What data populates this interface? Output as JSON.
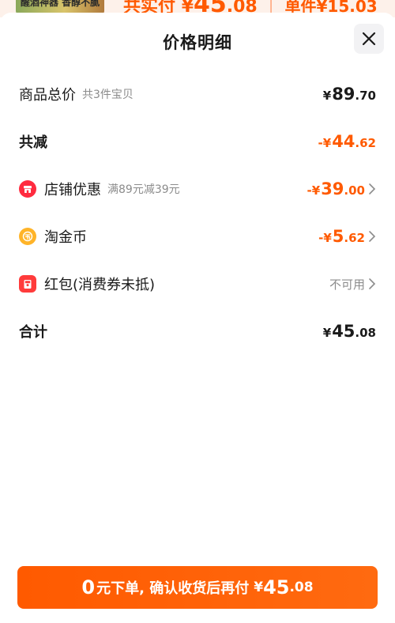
{
  "backdrop": {
    "thumb_text": "醒酒神器 香醇不腻",
    "price_prefix": "共实付",
    "price_symbol": "¥",
    "price_int": "45",
    "price_dec": ".08",
    "separator": "|",
    "unit_text": "单件¥15.03"
  },
  "sheet": {
    "title": "价格明细"
  },
  "rows": {
    "total": {
      "label": "商品总价",
      "sub": "共3件宝贝",
      "symbol": "¥",
      "int": "89",
      "dec": ".70"
    },
    "reduce": {
      "label": "共减",
      "symbol": "-¥",
      "int": "44",
      "dec": ".62"
    },
    "store": {
      "label": "店铺优惠",
      "sub": "满89元减39元",
      "symbol": "-¥",
      "int": "39",
      "dec": ".00"
    },
    "coin": {
      "label": "淘金币",
      "symbol": "-¥",
      "int": "5",
      "dec": ".62"
    },
    "packet": {
      "label": "红包(消费券未抵)",
      "status": "不可用"
    },
    "sum": {
      "label": "合计",
      "symbol": "¥",
      "int": "45",
      "dec": ".08"
    }
  },
  "cta": {
    "zero": "0",
    "text": "元下单, 确认收货后再付",
    "symbol": "¥",
    "int": "45",
    "dec": ".08"
  },
  "icons": {
    "store": "store-icon",
    "coin": "coin-icon",
    "packet": "red-packet-icon",
    "close": "close-icon",
    "chevron": "chevron-right-icon"
  },
  "colors": {
    "accent": "#ff5a00",
    "text": "#1a1a1a",
    "muted": "#8c8c8c"
  }
}
